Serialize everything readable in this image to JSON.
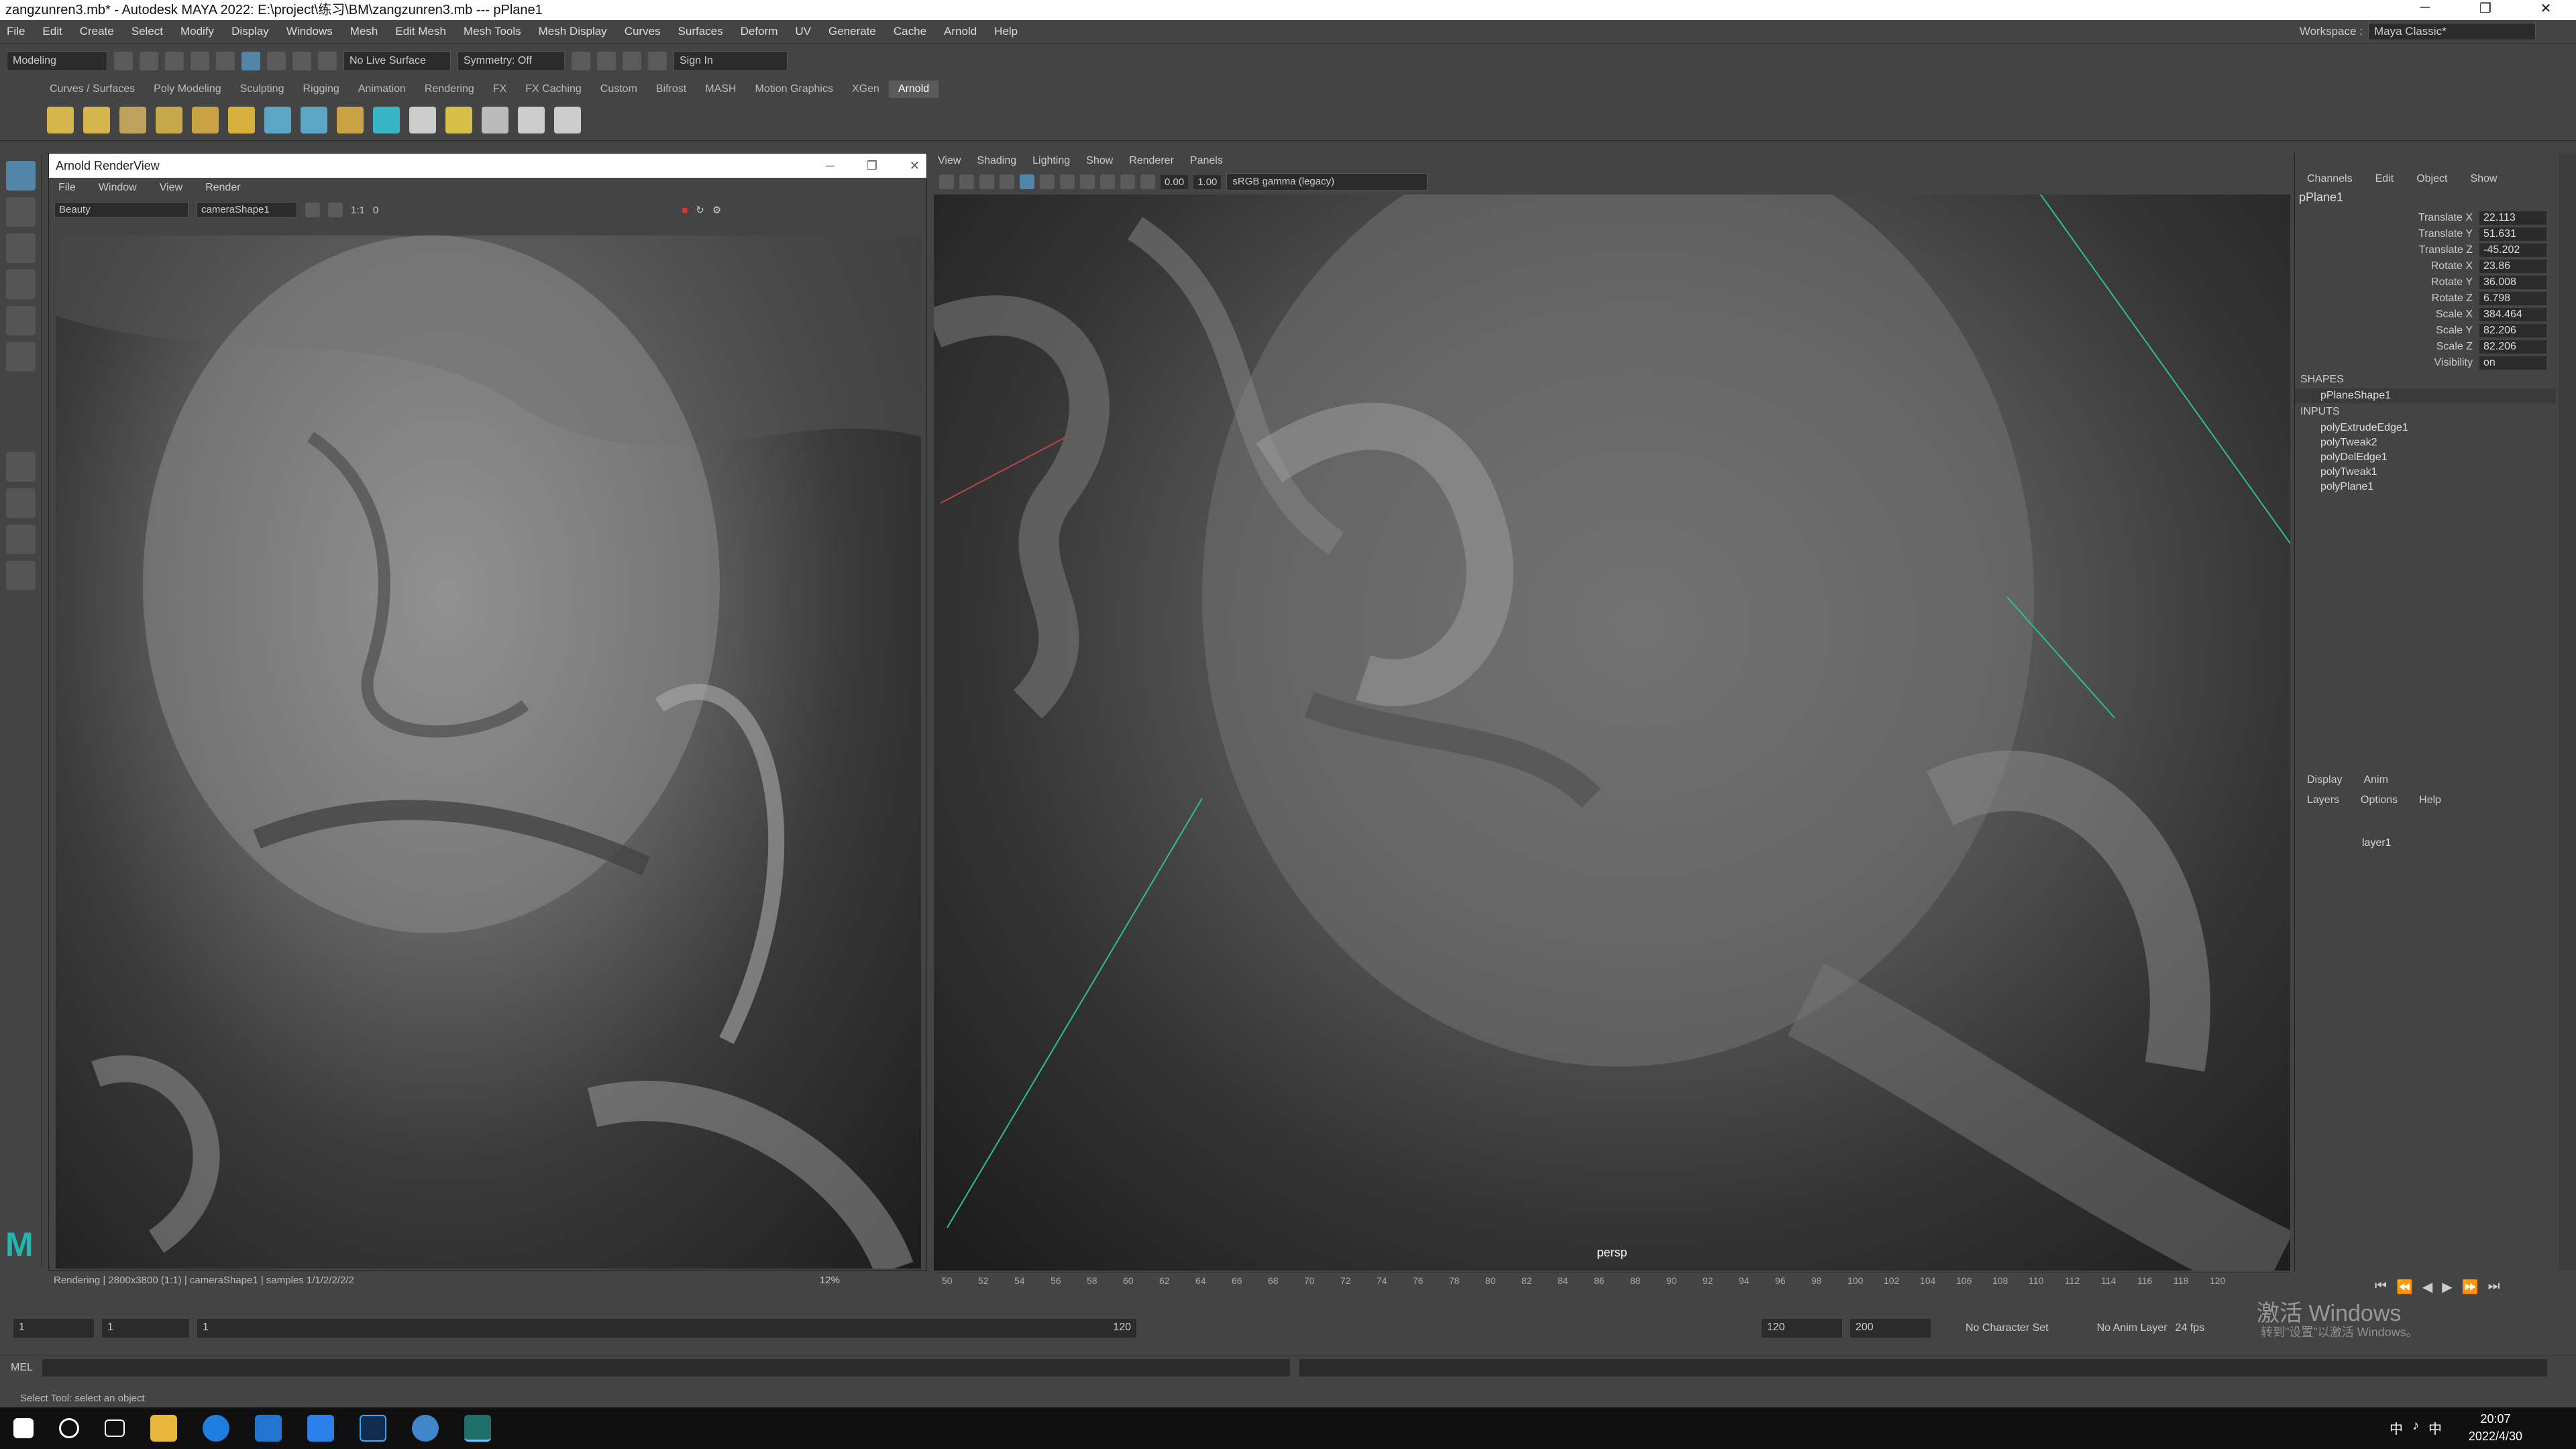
{
  "window": {
    "title": "zangzunren3.mb* - Autodesk MAYA 2022: E:\\project\\练习\\BM\\zangzunren3.mb   ---   pPlane1",
    "min": "─",
    "max": "❐",
    "close": "✕"
  },
  "menubar": [
    "File",
    "Edit",
    "Create",
    "Select",
    "Modify",
    "Display",
    "Windows",
    "Mesh",
    "Edit Mesh",
    "Mesh Tools",
    "Mesh Display",
    "Curves",
    "Surfaces",
    "Deform",
    "UV",
    "Generate",
    "Cache",
    "Arnold",
    "Help"
  ],
  "workspace": {
    "label": "Workspace :",
    "value": "Maya Classic*"
  },
  "statusline": {
    "mode": "Modeling",
    "live_surface": "No Live Surface",
    "symmetry": "Symmetry: Off",
    "sign_in": "Sign In"
  },
  "shelf_tabs": [
    "Curves / Surfaces",
    "Poly Modeling",
    "Sculpting",
    "Rigging",
    "Animation",
    "Rendering",
    "FX",
    "FX Caching",
    "Custom",
    "Bifrost",
    "MASH",
    "Motion Graphics",
    "XGen",
    "Arnold"
  ],
  "shelf_active": "Arnold",
  "renderview": {
    "title": "Arnold RenderView",
    "menu": [
      "File",
      "Window",
      "View",
      "Render"
    ],
    "aov": "Beauty",
    "camera": "cameraShape1",
    "ratio": "1:1",
    "exposure": "0",
    "status": "Rendering | 2800x3800 (1:1) | cameraShape1 | samples 1/1/2/2/2/2",
    "progress": "12%"
  },
  "viewport": {
    "menu": [
      "View",
      "Shading",
      "Lighting",
      "Show",
      "Renderer",
      "Panels"
    ],
    "exposure": "0.00",
    "gamma": "1.00",
    "colorspace": "sRGB gamma (legacy)",
    "camera_label": "persp"
  },
  "channelbox": {
    "tabs": [
      "Channels",
      "Edit",
      "Object",
      "Show"
    ],
    "object": "pPlane1",
    "attrs": [
      {
        "name": "Translate X",
        "value": "22.113"
      },
      {
        "name": "Translate Y",
        "value": "51.631"
      },
      {
        "name": "Translate Z",
        "value": "-45.202"
      },
      {
        "name": "Rotate X",
        "value": "23.86"
      },
      {
        "name": "Rotate Y",
        "value": "36.008"
      },
      {
        "name": "Rotate Z",
        "value": "6.798"
      },
      {
        "name": "Scale X",
        "value": "384.464"
      },
      {
        "name": "Scale Y",
        "value": "82.206"
      },
      {
        "name": "Scale Z",
        "value": "82.206"
      },
      {
        "name": "Visibility",
        "value": "on"
      }
    ],
    "shapes_label": "SHAPES",
    "shape": "pPlaneShape1",
    "inputs_label": "INPUTS",
    "inputs": [
      "polyExtrudeEdge1",
      "polyTweak2",
      "polyDelEdge1",
      "polyTweak1",
      "polyPlane1"
    ]
  },
  "layers": {
    "tabs": [
      "Display",
      "Anim"
    ],
    "menu": [
      "Layers",
      "Options",
      "Help"
    ],
    "layer": "layer1"
  },
  "timeline": {
    "ticks": [
      "50",
      "52",
      "54",
      "56",
      "58",
      "60",
      "62",
      "64",
      "66",
      "68",
      "70",
      "72",
      "74",
      "76",
      "78",
      "80",
      "82",
      "84",
      "86",
      "88",
      "90",
      "92",
      "94",
      "96",
      "98",
      "100",
      "102",
      "104",
      "106",
      "108",
      "110",
      "112",
      "114",
      "116",
      "118",
      "120"
    ]
  },
  "range": {
    "start": "1",
    "current": "1",
    "range_start": "1",
    "range_end": "120",
    "end": "120",
    "anim_end": "200",
    "char_set": "No Character Set",
    "anim_layer": "No Anim Layer",
    "fps": "24 fps"
  },
  "cmdline": {
    "label": "MEL"
  },
  "helpline": "Select Tool: select an object",
  "watermark": {
    "line1": "激活 Windows",
    "line2": "转到\"设置\"以激活 Windows。"
  },
  "clock": {
    "time": "20:07",
    "date": "2022/4/30"
  },
  "tray": [
    "中",
    "♪",
    "中"
  ]
}
